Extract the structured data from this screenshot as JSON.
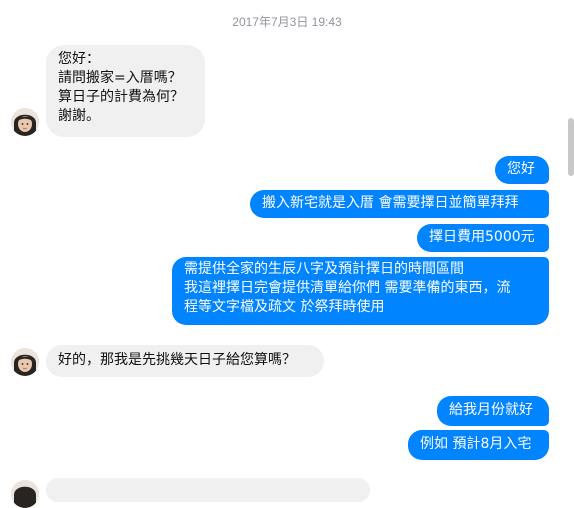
{
  "conversation": {
    "timestamp": "2017年7月3日 19:43",
    "messages": [
      {
        "lines": [
          "您好：",
          "請問搬家=入厝嗎？",
          "算日子的計費為何？",
          "謝謝。"
        ]
      },
      {
        "lines": [
          "您好"
        ]
      },
      {
        "lines": [
          "搬入新宅就是入厝 會需要擇日並簡單拜拜"
        ]
      },
      {
        "lines": [
          "擇日費用5000元"
        ]
      },
      {
        "lines": [
          "需提供全家的生辰八字及預計擇日的時間區間",
          "我這裡擇日完會提供清單給你們 需要準備的東西，流",
          "程等文字檔及疏文 於祭拜時使用"
        ]
      },
      {
        "lines": [
          "好的，那我是先挑幾天日子給您算嗎？"
        ]
      },
      {
        "lines": [
          "給我月份就好"
        ]
      },
      {
        "lines": [
          "例如 預計8月入宅"
        ]
      }
    ]
  },
  "colors": {
    "outgoing_bubble": "#0084ff",
    "incoming_bubble": "#f1f0f0",
    "timestamp_text": "#90949c"
  },
  "icons": {
    "avatar": "contact-avatar-icon"
  }
}
